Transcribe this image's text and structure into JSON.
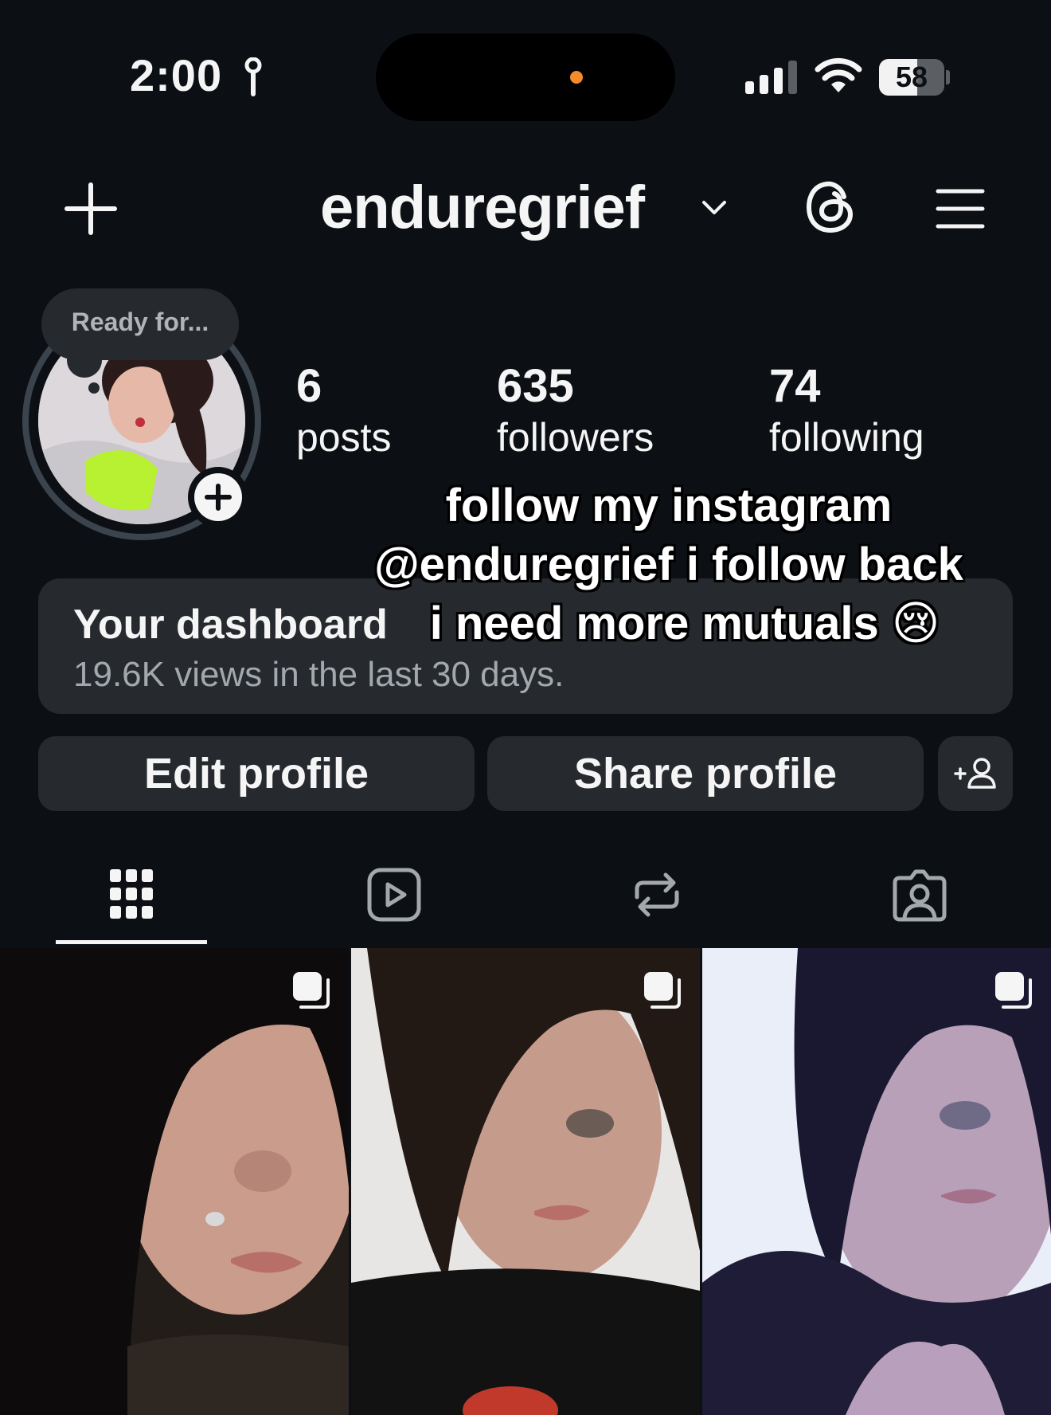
{
  "status_bar": {
    "time": "2:00",
    "battery_level": "58",
    "battery_fraction": 0.58
  },
  "header": {
    "username": "enduregrief"
  },
  "profile": {
    "note": "Ready for...",
    "stats": [
      {
        "value": "6",
        "label": "posts"
      },
      {
        "value": "635",
        "label": "followers"
      },
      {
        "value": "74",
        "label": "following"
      }
    ]
  },
  "overlay_caption": {
    "line1": "follow my instagram",
    "line2": "@enduregrief i follow back",
    "line3": "i need more mutuals 😢"
  },
  "dashboard": {
    "title": "Your dashboard",
    "subtitle": "19.6K views in the last 30 days."
  },
  "buttons": {
    "edit_profile": "Edit profile",
    "share_profile": "Share profile"
  },
  "tabs": [
    "grid-icon",
    "reels-icon",
    "reposts-icon",
    "tagged-icon"
  ],
  "colors": {
    "background": "#0c1014",
    "surface": "#262a2f",
    "text": "#f5f5f5",
    "muted": "#a3a8ad",
    "island_dot": "#f58b28"
  }
}
